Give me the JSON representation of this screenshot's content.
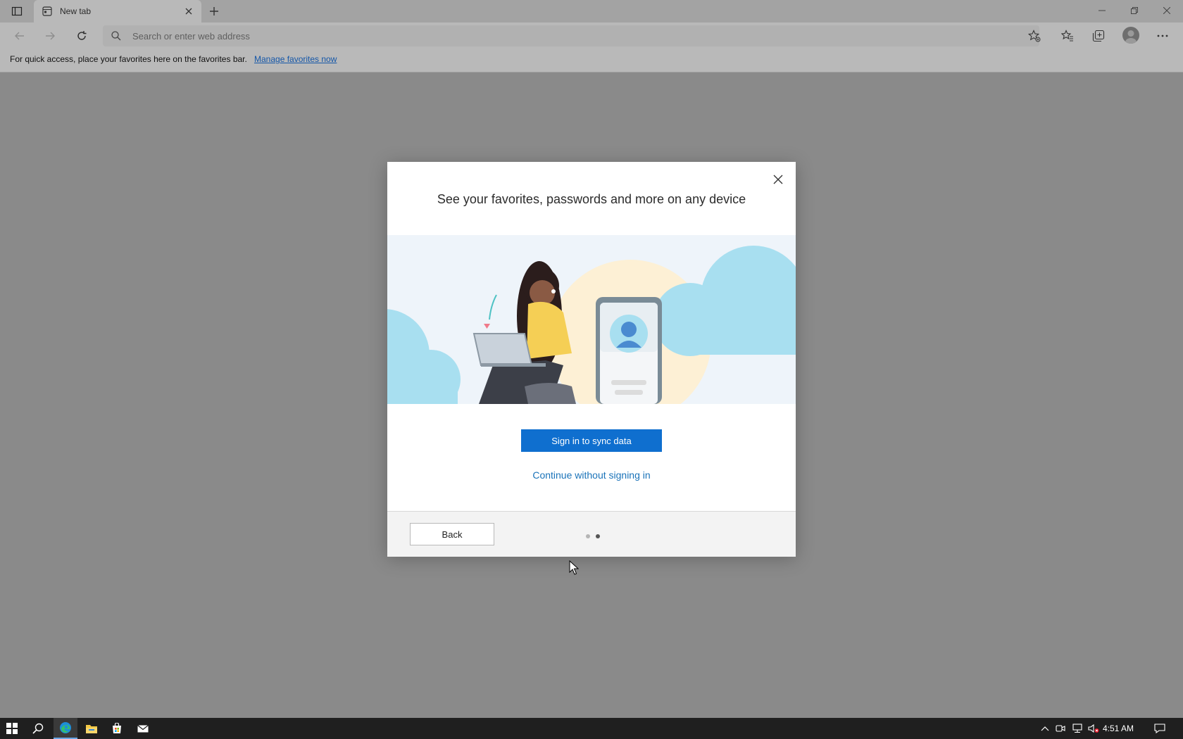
{
  "browser": {
    "tab_title": "New tab",
    "address_placeholder": "Search or enter web address",
    "favorites_bar_message": "For quick access, place your favorites here on the favorites bar.",
    "favorites_bar_link": "Manage favorites now",
    "toolbar_icons": [
      "back-icon",
      "forward-icon",
      "refresh-icon",
      "search-icon",
      "add-favorite-icon",
      "favorites-icon",
      "collections-icon",
      "profile-icon",
      "more-icon"
    ]
  },
  "dialog": {
    "title": "See your favorites, passwords and more on any device",
    "primary_button": "Sign in to sync data",
    "secondary_link": "Continue without signing in",
    "back_button": "Back",
    "pager": {
      "total": 2,
      "current": 2
    }
  },
  "taskbar": {
    "time": "4:51 AM",
    "apps": [
      "start-icon",
      "search-icon",
      "edge-icon",
      "file-explorer-icon",
      "store-icon",
      "mail-icon"
    ]
  },
  "colors": {
    "primary_button": "#0f6fcf",
    "link": "#1a73b9",
    "overlay_page": "#8a8a8a"
  }
}
